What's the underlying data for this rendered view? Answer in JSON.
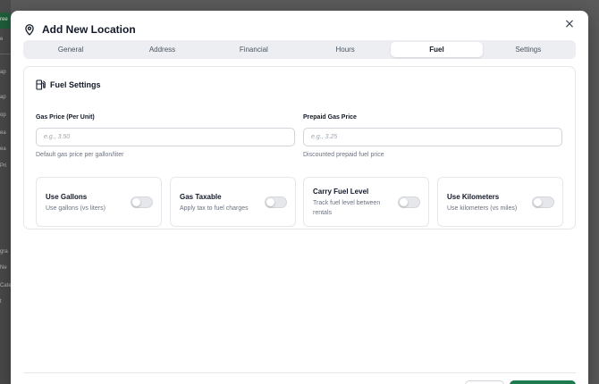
{
  "modal": {
    "title": "Add New Location",
    "close_label": "×"
  },
  "tabs": [
    {
      "label": "General",
      "active": false
    },
    {
      "label": "Address",
      "active": false
    },
    {
      "label": "Financial",
      "active": false
    },
    {
      "label": "Hours",
      "active": false
    },
    {
      "label": "Fuel",
      "active": true
    },
    {
      "label": "Settings",
      "active": false
    }
  ],
  "section": {
    "title": "Fuel Settings",
    "icon": "fuel-pump-icon"
  },
  "fields": {
    "gas_price": {
      "label": "Gas Price (Per Unit)",
      "value": "",
      "placeholder": "e.g., 3.50",
      "help": "Default gas price per gallon/liter"
    },
    "prepaid_gas_price": {
      "label": "Prepaid Gas Price",
      "value": "",
      "placeholder": "e.g., 3.25",
      "help": "Discounted prepaid fuel price"
    }
  },
  "toggles": [
    {
      "title": "Use Gallons",
      "description": "Use gallons (vs liters)",
      "on": false
    },
    {
      "title": "Gas Taxable",
      "description": "Apply tax to fuel charges",
      "on": false
    },
    {
      "title": "Carry Fuel Level",
      "description": "Track fuel level between rentals",
      "on": false
    },
    {
      "title": "Use Kilometers",
      "description": "Use kilometers (vs miles)",
      "on": false
    }
  ],
  "background": {
    "fragments": [
      "ree",
      "e",
      "ap",
      "op",
      "ea",
      "Pri",
      "gra",
      "Ne",
      "Cate",
      "t"
    ]
  },
  "colors": {
    "primary": "#1f7a4d",
    "overlay": "#5b5b5b",
    "tab_bg": "#eceef1",
    "border": "#e5e7eb"
  }
}
